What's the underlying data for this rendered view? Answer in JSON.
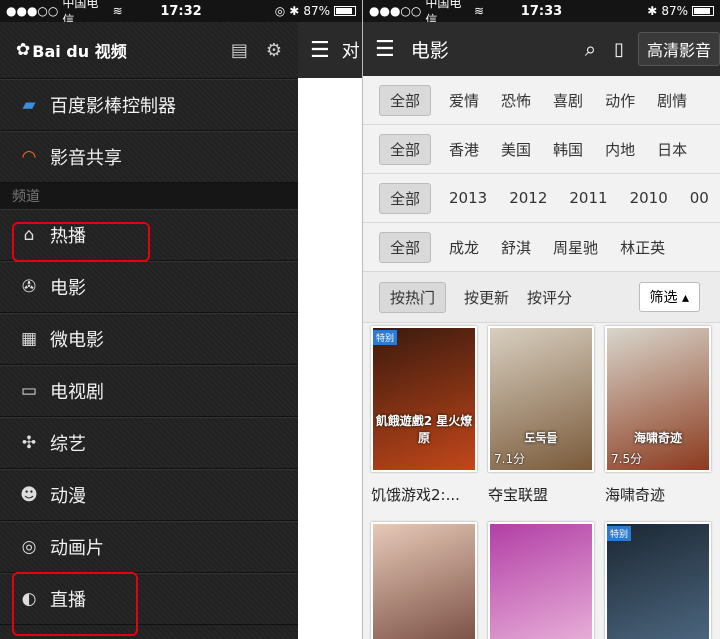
{
  "status": {
    "carrier": "中国电信",
    "time": "17:32",
    "time_right": "17:33",
    "battery": "87%"
  },
  "drawer": {
    "logo": "Bai du 视频",
    "items_top": [
      {
        "label": "百度影棒控制器",
        "icon": "usb-stick-icon"
      },
      {
        "label": "影音共享",
        "icon": "wifi-icon"
      }
    ],
    "section_label": "频道",
    "channels": [
      {
        "label": "热播",
        "icon": "home-icon"
      },
      {
        "label": "电影",
        "icon": "film-reel-icon"
      },
      {
        "label": "微电影",
        "icon": "clapperboard-icon"
      },
      {
        "label": "电视剧",
        "icon": "tv-icon"
      },
      {
        "label": "综艺",
        "icon": "pinwheel-icon"
      },
      {
        "label": "动漫",
        "icon": "bear-icon"
      },
      {
        "label": "动画片",
        "icon": "spiral-icon"
      },
      {
        "label": "直播",
        "icon": "satellite-icon"
      }
    ],
    "behind_title": "对"
  },
  "app": {
    "title": "电影",
    "quality_label": "高清影音",
    "filters": [
      [
        "全部",
        "爱情",
        "恐怖",
        "喜剧",
        "动作",
        "剧情"
      ],
      [
        "全部",
        "香港",
        "美国",
        "韩国",
        "内地",
        "日本"
      ],
      [
        "全部",
        "2013",
        "2012",
        "2011",
        "2010",
        "00"
      ],
      [
        "全部",
        "成龙",
        "舒淇",
        "周星驰",
        "林正英"
      ]
    ],
    "sort": [
      "按热门",
      "按更新",
      "按评分"
    ],
    "filter_button": "筛选 ▴",
    "movies": [
      {
        "name": "饥饿游戏2:...",
        "tag": "特别",
        "score": "",
        "poster_text": "飢餓遊戲2 星火燎原",
        "colors": [
          "#3b1a0e",
          "#c2471a"
        ]
      },
      {
        "name": "夺宝联盟",
        "tag": "",
        "score": "7.1分",
        "poster_text": "도둑들",
        "colors": [
          "#d8cfc0",
          "#7a5a3a"
        ]
      },
      {
        "name": "海啸奇迹",
        "tag": "",
        "score": "7.5分",
        "poster_text": "海啸奇迹",
        "colors": [
          "#d9d6cc",
          "#8b3a1e"
        ]
      },
      {
        "name": "",
        "tag": "",
        "score": "",
        "poster_text": "",
        "colors": [
          "#e7c9b8",
          "#6a3f33"
        ]
      },
      {
        "name": "",
        "tag": "",
        "score": "",
        "poster_text": "",
        "colors": [
          "#b23fa6",
          "#f0c0e0"
        ]
      },
      {
        "name": "",
        "tag": "特别",
        "score": "",
        "poster_text": "",
        "colors": [
          "#1b2733",
          "#54708a"
        ]
      }
    ]
  }
}
